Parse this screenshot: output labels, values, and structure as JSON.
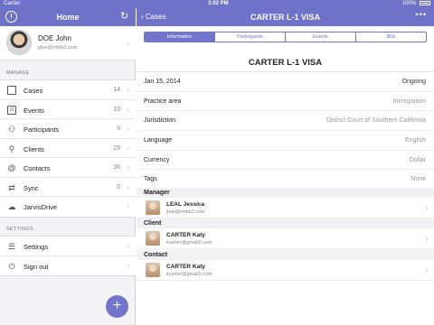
{
  "status_bar": {
    "carrier": "Carrier",
    "time": "3:02 PM",
    "battery": "100%"
  },
  "sidebar": {
    "title": "Home",
    "profile": {
      "name": "DOE John",
      "email": "jdoe@rmkb2.com"
    },
    "manage_label": "MANAGE",
    "items": [
      {
        "label": "Cases",
        "count": "14",
        "icon": "folder-icon"
      },
      {
        "label": "Events",
        "count": "10",
        "icon": "calendar-icon"
      },
      {
        "label": "Participants",
        "count": "9",
        "icon": "people-icon"
      },
      {
        "label": "Clients",
        "count": "29",
        "icon": "person-icon"
      },
      {
        "label": "Contacts",
        "count": "36",
        "icon": "at-icon"
      },
      {
        "label": "Sync",
        "count": "0",
        "icon": "sync-icon"
      },
      {
        "label": "JarvisDrive",
        "count": "",
        "icon": "cloud-icon"
      }
    ],
    "settings_label": "SETTINGS",
    "settings_items": [
      {
        "label": "Settings",
        "icon": "settings-icon"
      },
      {
        "label": "Sign out",
        "icon": "power-icon"
      }
    ],
    "fab": "+"
  },
  "detail": {
    "back_label": "Cases",
    "title": "CARTER L-1 VISA",
    "more": "•••",
    "tabs": [
      {
        "label": "Information",
        "active": true
      },
      {
        "label": "Participants",
        "active": false
      },
      {
        "label": "Events",
        "active": false
      },
      {
        "label": "Bills",
        "active": false
      }
    ],
    "case_title": "CARTER L-1 VISA",
    "fields": [
      {
        "key": "Jan 15, 2014",
        "value": "Ongoing"
      },
      {
        "key": "Practice area",
        "value": "Immigration"
      },
      {
        "key": "Jurisdiction",
        "value": "District Court of Southern California"
      },
      {
        "key": "Language",
        "value": "English"
      },
      {
        "key": "Currency",
        "value": "Dollar"
      },
      {
        "key": "Tags",
        "value": "None"
      }
    ],
    "groups": [
      {
        "label": "Manager",
        "name": "LEAL Jessica",
        "email": "jleal@rmkb2.com"
      },
      {
        "label": "Client",
        "name": "CARTER Katy",
        "email": "kcarter@gmail2.com"
      },
      {
        "label": "Contact",
        "name": "CARTER Katy",
        "email": "kcarter@gmail2.com"
      }
    ]
  }
}
